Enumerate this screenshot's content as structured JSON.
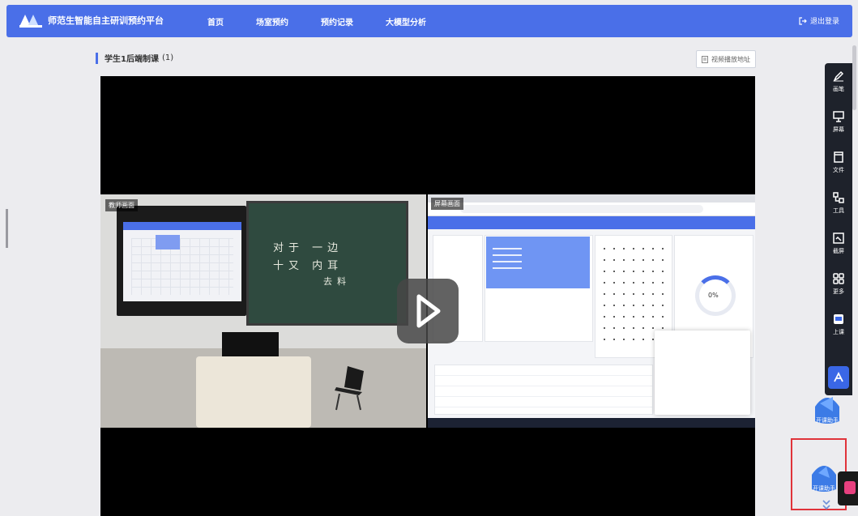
{
  "header": {
    "logo_text": "师范生智能自主研训预约平台",
    "nav": [
      "首页",
      "场室预约",
      "预约记录",
      "大模型分析"
    ],
    "logout": "退出登录"
  },
  "content": {
    "section_title": "学生1后端制课",
    "section_count": "(1)",
    "video_url_button": "视频播放地址",
    "player": {
      "left_label": "教师画面",
      "right_label": "屏幕画面",
      "board_line1": "对于 一边",
      "board_line2": "十又 内耳",
      "board_line3": "去料",
      "donut_value": "0%"
    }
  },
  "toolbar": {
    "items": [
      "画笔",
      "屏幕",
      "文件",
      "工具",
      "截屏",
      "更多",
      "上课"
    ]
  },
  "floating": {
    "button1": "开课助手",
    "button2": "开课助手"
  },
  "colors": {
    "primary": "#4a6fe8",
    "toolbar_bg": "#1e222b",
    "highlight": "#e0333a"
  }
}
